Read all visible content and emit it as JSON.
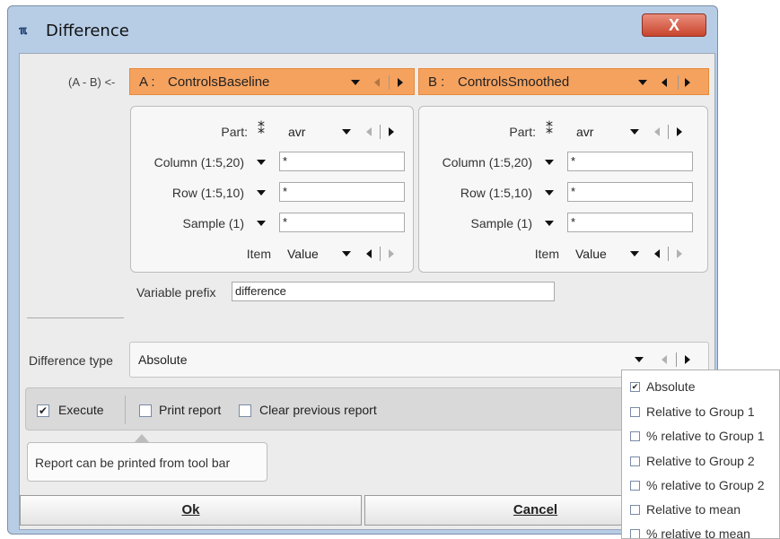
{
  "window": {
    "title": "Difference",
    "icon": "app-logo-icon",
    "close_label": "X"
  },
  "formula_label": "(A - B) <-",
  "selector_a": {
    "prefix": "A :",
    "value": "ControlsBaseline",
    "panel": {
      "part_label": "Part:",
      "part_value": "avr",
      "column_label": "Column (1:5,20)",
      "column_value": "*",
      "row_label": "Row (1:5,10)",
      "row_value": "*",
      "sample_label": "Sample (1)",
      "sample_value": "*",
      "item_label": "Item",
      "item_value": "Value"
    }
  },
  "selector_b": {
    "prefix": "B :",
    "value": "ControlsSmoothed",
    "panel": {
      "part_label": "Part:",
      "part_value": "avr",
      "column_label": "Column (1:5,20)",
      "column_value": "*",
      "row_label": "Row (1:5,10)",
      "row_value": "*",
      "sample_label": "Sample (1)",
      "sample_value": "*",
      "item_label": "Item",
      "item_value": "Value"
    }
  },
  "variable_prefix": {
    "label": "Variable prefix",
    "value": "difference"
  },
  "difference_type": {
    "label": "Difference type",
    "value": "Absolute"
  },
  "options": {
    "execute": {
      "label": "Execute",
      "checked": true
    },
    "print_report": {
      "label": "Print report",
      "checked": false
    },
    "clear_previous_report": {
      "label": "Clear previous report",
      "checked": false
    }
  },
  "tooltip": "Report can be printed from tool bar",
  "buttons": {
    "ok": "Ok",
    "cancel": "Cancel"
  },
  "dropdown_options": [
    {
      "label": "Absolute",
      "checked": true
    },
    {
      "label": "Relative to Group 1",
      "checked": false
    },
    {
      "label": "% relative to Group 1",
      "checked": false
    },
    {
      "label": "Relative to Group 2",
      "checked": false
    },
    {
      "label": "% relative to Group 2",
      "checked": false
    },
    {
      "label": "Relative to mean",
      "checked": false
    },
    {
      "label": "% relative to mean",
      "checked": false
    }
  ],
  "colors": {
    "accent_orange": "#f5a25f",
    "title_bar": "#b7cde6",
    "close_red": "#c9452d"
  }
}
